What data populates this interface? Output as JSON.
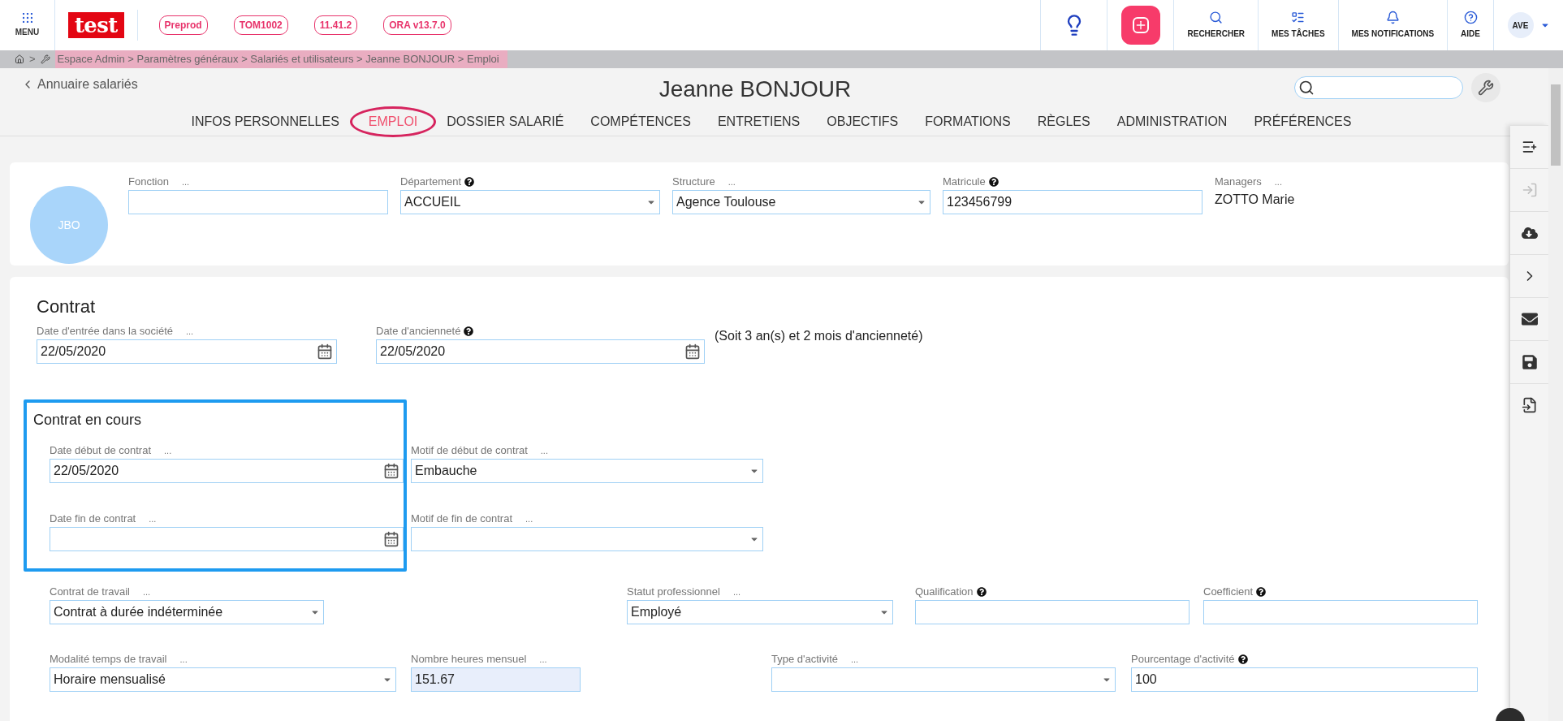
{
  "topbar": {
    "menu_label": "MENU",
    "logo": "test",
    "badges": [
      "Preprod",
      "TOM1002",
      "11.41.2",
      "ORA v13.7.0"
    ],
    "actions": [
      {
        "kind": "search",
        "label": "RECHERCHER"
      },
      {
        "kind": "tasks",
        "label": "MES TÂCHES"
      },
      {
        "kind": "bell",
        "label": "MES NOTIFICATIONS"
      },
      {
        "kind": "help",
        "label": "AIDE"
      }
    ],
    "user": "AVE"
  },
  "breadcrumb": {
    "separator": ">",
    "path": "Espace Admin > Paramètres généraux > Salariés et utilisateurs > Jeanne BONJOUR > Emploi"
  },
  "header": {
    "back_link": "Annuaire salariés",
    "title": "Jeanne BONJOUR"
  },
  "tabs": [
    {
      "label": "INFOS PERSONNELLES",
      "selected": false
    },
    {
      "label": "EMPLOI",
      "selected": true
    },
    {
      "label": "DOSSIER SALARIÉ",
      "selected": false
    },
    {
      "label": "COMPÉTENCES",
      "selected": false
    },
    {
      "label": "ENTRETIENS",
      "selected": false
    },
    {
      "label": "OBJECTIFS",
      "selected": false
    },
    {
      "label": "FORMATIONS",
      "selected": false
    },
    {
      "label": "RÈGLES",
      "selected": false
    },
    {
      "label": "ADMINISTRATION",
      "selected": false
    },
    {
      "label": "PRÉFÉRENCES",
      "selected": false
    }
  ],
  "identity": {
    "avatar": "JBO",
    "fields": [
      {
        "label": "Fonction",
        "more": "...",
        "help": false,
        "kind": "text"
      },
      {
        "label": "Département",
        "help": true,
        "kind": "select",
        "value": "ACCUEIL"
      },
      {
        "label": "Structure",
        "more": "...",
        "help": false,
        "kind": "select",
        "value": "Agence Toulouse"
      },
      {
        "label": "Matricule",
        "help": true,
        "kind": "text",
        "value": "123456799"
      },
      {
        "label": "Managers",
        "more": "...",
        "help": false,
        "kind": "plain",
        "value": "ZOTTO Marie"
      }
    ]
  },
  "contrat": {
    "title": "Contrat",
    "dates": [
      {
        "label": "Date d'entrée dans la société",
        "more": "...",
        "help": false,
        "kind": "date",
        "value": "22/05/2020"
      },
      {
        "label": "Date d'ancienneté",
        "help": true,
        "kind": "date",
        "value": "22/05/2020"
      }
    ],
    "seniority": "(Soit 3 an(s) et 2 mois d'ancienneté)",
    "current": {
      "title": "Contrat en cours",
      "fields": [
        {
          "label": "Date début de contrat",
          "more": "...",
          "help": false,
          "kind": "date",
          "value": "22/05/2020"
        },
        {
          "label": "Date fin de contrat",
          "more": "...",
          "help": false,
          "kind": "date"
        }
      ]
    },
    "reasons": [
      {
        "label": "Motif de début de contrat",
        "more": "...",
        "help": false,
        "kind": "select",
        "value": "Embauche"
      },
      {
        "label": "Motif de fin de contrat",
        "more": "...",
        "help": false,
        "kind": "select"
      }
    ],
    "row_1": [
      {
        "label": "Contrat de travail",
        "more": "...",
        "help": false,
        "kind": "select",
        "value": "Contrat à durée indéterminée"
      },
      {
        "label": "Statut professionnel",
        "more": "...",
        "help": false,
        "kind": "select",
        "value": "Employé"
      },
      {
        "label": "Qualification",
        "help": true,
        "kind": "text"
      },
      {
        "label": "Coefficient",
        "help": true,
        "kind": "text"
      }
    ],
    "row_2": [
      {
        "label": "Modalité temps de travail",
        "more": "...",
        "help": false,
        "kind": "select",
        "value": "Horaire mensualisé"
      },
      {
        "label": "Nombre heures mensuel",
        "more": "...",
        "help": false,
        "kind": "readonly",
        "value": "151.67"
      },
      {
        "label": "Type d'activité",
        "more": "...",
        "help": false,
        "kind": "select"
      },
      {
        "label": "Pourcentage d'activité",
        "help": true,
        "kind": "text",
        "value": "100"
      }
    ]
  },
  "rail": [
    {
      "kind": "add-list",
      "disabled": false
    },
    {
      "kind": "enter",
      "disabled": true
    },
    {
      "kind": "cloud",
      "disabled": false
    },
    {
      "kind": "chevron",
      "disabled": false
    },
    {
      "kind": "mail",
      "disabled": false
    },
    {
      "kind": "save",
      "disabled": false
    },
    {
      "kind": "swap",
      "disabled": false
    }
  ]
}
